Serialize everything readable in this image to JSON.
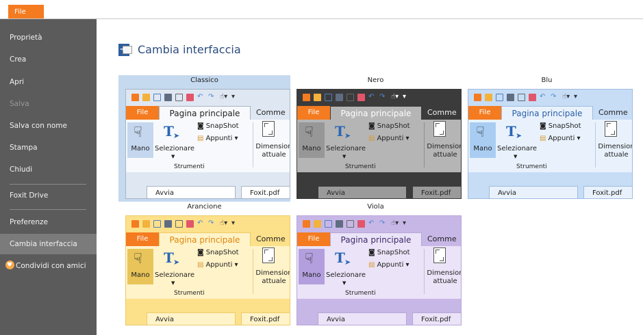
{
  "menu": {
    "file_label": "File"
  },
  "sidebar": {
    "items": [
      {
        "label": "Proprietà"
      },
      {
        "label": "Crea"
      },
      {
        "label": "Apri"
      },
      {
        "label": "Salva"
      },
      {
        "label": "Salva con nome"
      },
      {
        "label": "Stampa"
      },
      {
        "label": "Chiudi"
      },
      {
        "label": "Foxit Drive"
      },
      {
        "label": "Preferenze"
      },
      {
        "label": "Cambia interfaccia"
      },
      {
        "label": "Condividi con amici"
      }
    ]
  },
  "main": {
    "title": "Cambia interfaccia"
  },
  "preview_text": {
    "file_tab": "File",
    "home_tab": "Pagina principale",
    "comment_tab": "Comme",
    "hand_tool": "Mano",
    "select_tool": "Selezionare",
    "snapshot": "SnapShot",
    "clipboard": "Appunti",
    "group_label": "Strumenti",
    "actual_size_line1": "Dimension",
    "actual_size_line2": "attuale",
    "start_tab": "Avvia",
    "doc_tab": "Foxit.pdf"
  },
  "themes": [
    {
      "name": "Classico",
      "selected": true,
      "colors": {
        "qat": "#dfe7f2",
        "tabrow": "#dfe7f2",
        "tab_active": "#f7f9fc",
        "home_text": "#222222",
        "ribbon": "#f7f9fc",
        "mano_bg": "#c5d7ee",
        "text": "#222222",
        "tabstrip": "#dfe7f2",
        "doctab": "#ffffff",
        "sep": "#c6cfdb",
        "border": "#a7b4c6"
      }
    },
    {
      "name": "Nero",
      "selected": false,
      "colors": {
        "qat": "#3b3b3b",
        "tabrow": "#3b3b3b",
        "tab_active": "#b5b5b5",
        "home_text": "#ffffff",
        "ribbon": "#b5b5b5",
        "mano_bg": "#979797",
        "text": "#222222",
        "tabstrip": "#3b3b3b",
        "doctab": "#9a9a9a",
        "sep": "#8e8e8e",
        "border": "#3b3b3b"
      }
    },
    {
      "name": "Blu",
      "selected": false,
      "colors": {
        "qat": "#c7ddf6",
        "tabrow": "#c7ddf6",
        "tab_active": "#e9f2fc",
        "home_text": "#2b5ea8",
        "ribbon": "#e9f2fc",
        "mano_bg": "#a9cdf2",
        "text": "#222222",
        "tabstrip": "#c7ddf6",
        "doctab": "#e9f2fc",
        "sep": "#b7cbe3",
        "border": "#9fbbe0"
      }
    },
    {
      "name": "Arancione",
      "selected": false,
      "colors": {
        "qat": "#fce08a",
        "tabrow": "#fce08a",
        "tab_active": "#fff3c9",
        "home_text": "#e0870c",
        "ribbon": "#fff3c9",
        "mano_bg": "#e8c45a",
        "text": "#222222",
        "tabstrip": "#fce08a",
        "doctab": "#fff3c9",
        "sep": "#e6cf85",
        "border": "#eccb6a"
      }
    },
    {
      "name": "Viola",
      "selected": false,
      "colors": {
        "qat": "#c7b7e6",
        "tabrow": "#c7b7e6",
        "tab_active": "#ebe3f7",
        "home_text": "#3c2a6a",
        "ribbon": "#ebe3f7",
        "mano_bg": "#b39fdd",
        "text": "#222222",
        "tabstrip": "#c7b7e6",
        "doctab": "#ebe3f7",
        "sep": "#c8bde0",
        "border": "#b7a6d9"
      }
    }
  ]
}
